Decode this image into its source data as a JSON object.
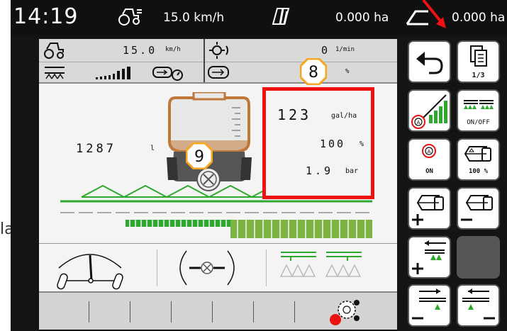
{
  "outside_label": "la",
  "top_bar": {
    "time": "14:19",
    "speed": "15.0 km/h",
    "area1": "0.000 ha",
    "area2": "0.000 ha"
  },
  "info": {
    "speed_value": "15.0",
    "speed_unit": "km/h",
    "rpm_value": "0",
    "rpm_unit": "1/min",
    "percent_unit": "%"
  },
  "tank": {
    "value": "1287",
    "unit": "l"
  },
  "application": {
    "rate": "123",
    "rate_unit": "gal/ha",
    "percent": "100",
    "percent_unit": "%",
    "pressure": "1.9",
    "pressure_unit": "bar"
  },
  "badges": {
    "b8": "8",
    "b9": "9"
  },
  "buttons": {
    "page_indicator": "1/3",
    "on_off": "ON/OFF",
    "on": "ON",
    "hundred_pct": "100 %"
  },
  "colors": {
    "accent_red": "#e11111",
    "green": "#2ea82e",
    "badge_orange": "#f5a623"
  }
}
